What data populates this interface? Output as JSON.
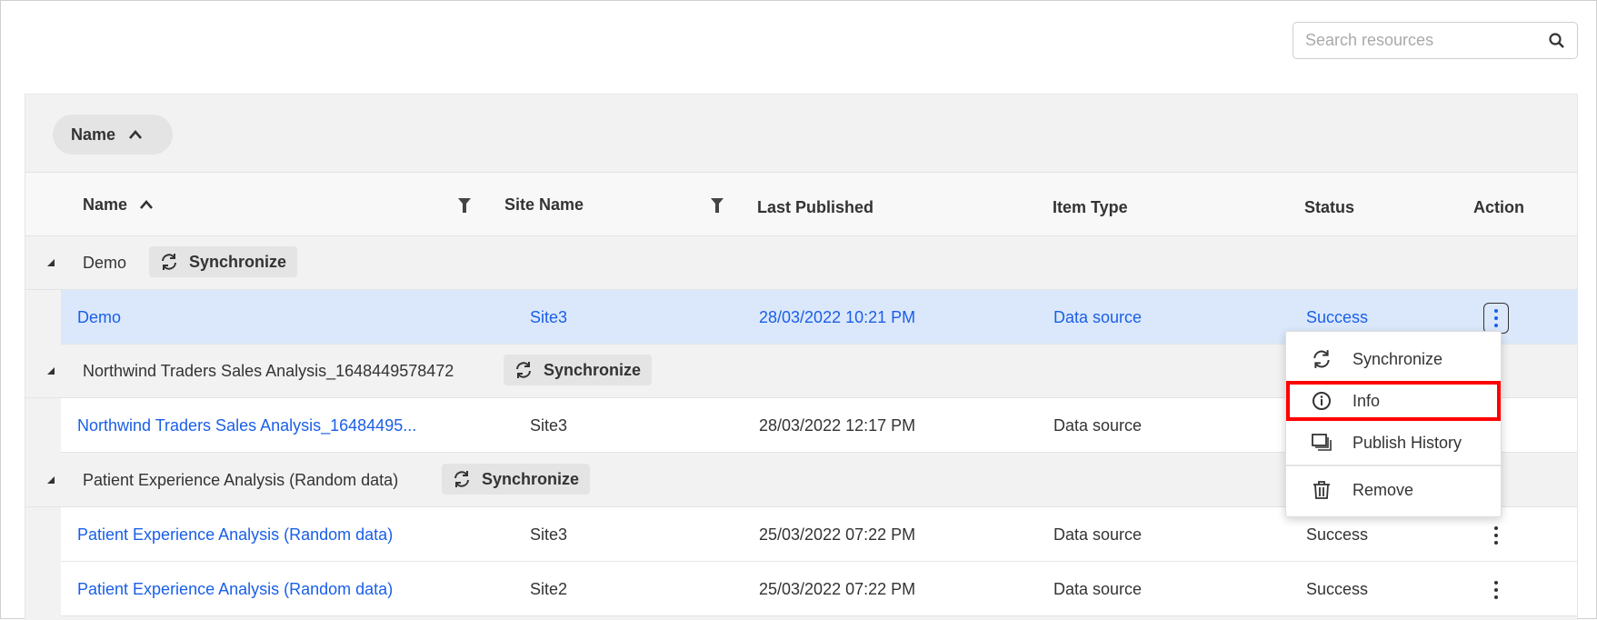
{
  "search": {
    "placeholder": "Search resources",
    "icon": "search-icon"
  },
  "grouping": {
    "chip_label": "Name",
    "chip_icon": "chevron-up-icon"
  },
  "columns": [
    "Name",
    "Site Name",
    "Last Published",
    "Item Type",
    "Status",
    "Action"
  ],
  "groups": [
    {
      "name": "Demo",
      "sync_label": "Synchronize",
      "rows": [
        {
          "name": "Demo",
          "site": "Site3",
          "published": "28/03/2022 10:21 PM",
          "type": "Data source",
          "status": "Success"
        }
      ]
    },
    {
      "name": "Northwind Traders Sales Analysis_1648449578472",
      "sync_label": "Synchronize",
      "rows": [
        {
          "name": "Northwind Traders Sales Analysis_16484495...",
          "site": "Site3",
          "published": "28/03/2022 12:17 PM",
          "type": "Data source",
          "status": ""
        }
      ]
    },
    {
      "name": "Patient Experience Analysis (Random data)",
      "sync_label": "Synchronize",
      "rows": [
        {
          "name": "Patient Experience Analysis (Random data)",
          "site": "Site3",
          "published": "25/03/2022 07:22 PM",
          "type": "Data source",
          "status": "Success"
        },
        {
          "name": "Patient Experience Analysis (Random data)",
          "site": "Site2",
          "published": "25/03/2022 07:22 PM",
          "type": "Data source",
          "status": "Success"
        }
      ]
    }
  ],
  "menu": {
    "items": [
      "Synchronize",
      "Info",
      "Publish History",
      "Remove"
    ],
    "highlighted": "Info"
  },
  "colors": {
    "link": "#1a5fe8",
    "selected_row": "#dbe8fb",
    "highlight_box": "#ff0000"
  }
}
